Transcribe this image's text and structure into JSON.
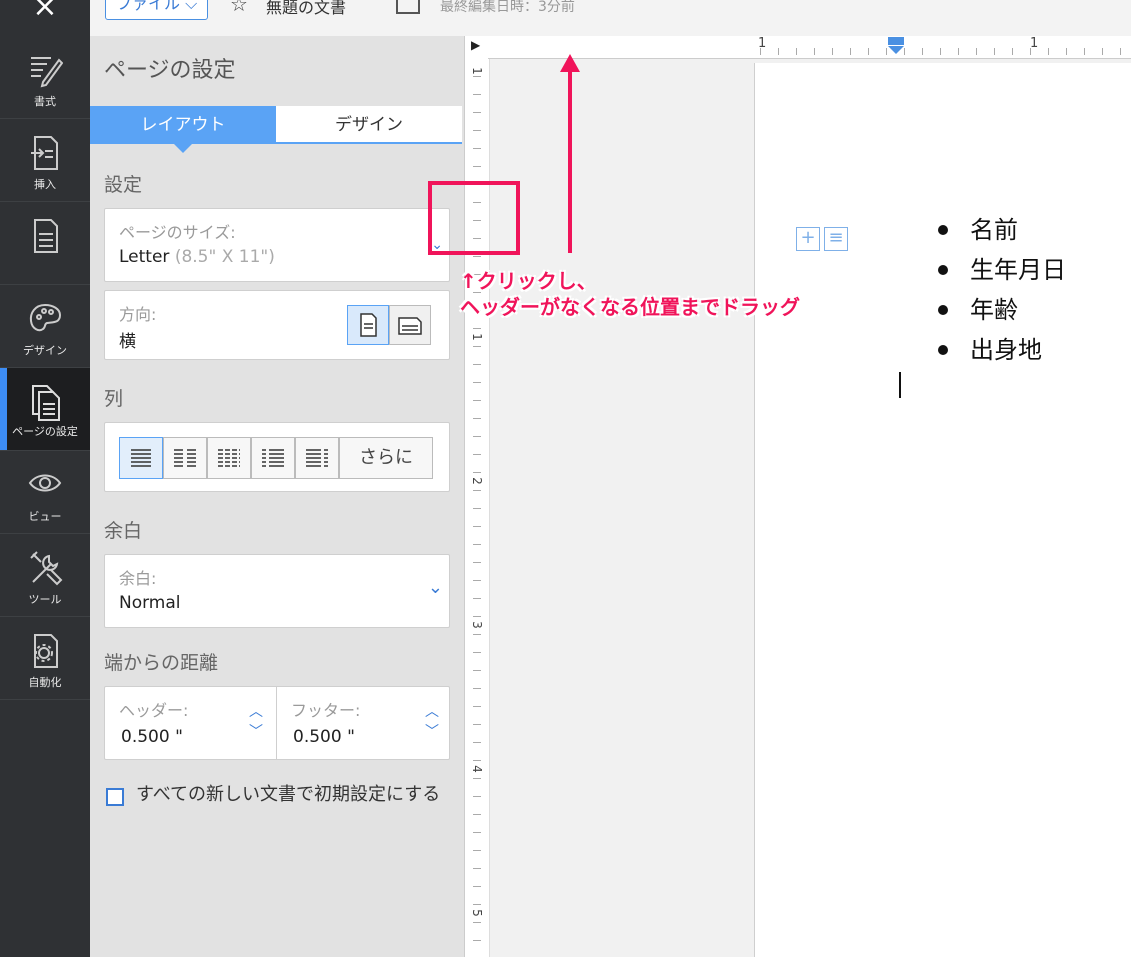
{
  "topbar": {
    "close_icon": "close-icon",
    "file_button": "ファイル",
    "doc_title": "無題の文書",
    "last_edited": "最終編集日時：3分前"
  },
  "nav": {
    "items": [
      {
        "label": "書式",
        "icon": "pen-icon"
      },
      {
        "label": "挿入",
        "icon": "insert-icon"
      },
      {
        "label": "",
        "icon": "document-icon"
      },
      {
        "label": "デザイン",
        "icon": "palette-icon"
      },
      {
        "label": "ページの設定",
        "icon": "page-setup-icon",
        "active": true
      },
      {
        "label": "ビュー",
        "icon": "eye-icon"
      },
      {
        "label": "ツール",
        "icon": "tools-icon"
      },
      {
        "label": "自動化",
        "icon": "automation-icon"
      }
    ]
  },
  "panel": {
    "title": "ページの設定",
    "tabs": [
      "レイアウト",
      "デザイン"
    ],
    "settings_heading": "設定",
    "page_size": {
      "label": "ページのサイズ:",
      "value": "Letter",
      "detail": "(8.5\" X 11\")"
    },
    "orientation": {
      "label": "方向:",
      "value": "横"
    },
    "columns_heading": "列",
    "columns_more": "さらに",
    "margins_heading": "余白",
    "margins": {
      "label": "余白:",
      "value": "Normal"
    },
    "distance_heading": "端からの距離",
    "header": {
      "label": "ヘッダー:",
      "value": "0.500 \""
    },
    "footer": {
      "label": "フッター:",
      "value": "0.500 \""
    },
    "default_checkbox_label": "すべての新しい文書で初期設定にする"
  },
  "ruler": {
    "horizontal_numbers": [
      "1",
      "1"
    ],
    "vertical_numbers": [
      "1",
      "1",
      "2",
      "3",
      "4",
      "5"
    ]
  },
  "document": {
    "bullets": [
      "名前",
      "生年月日",
      "年齢",
      "出身地"
    ]
  },
  "annotation": {
    "line1": "クリックし、",
    "line2": "ヘッダーがなくなる位置までドラッグ",
    "color": "#f0145a"
  }
}
